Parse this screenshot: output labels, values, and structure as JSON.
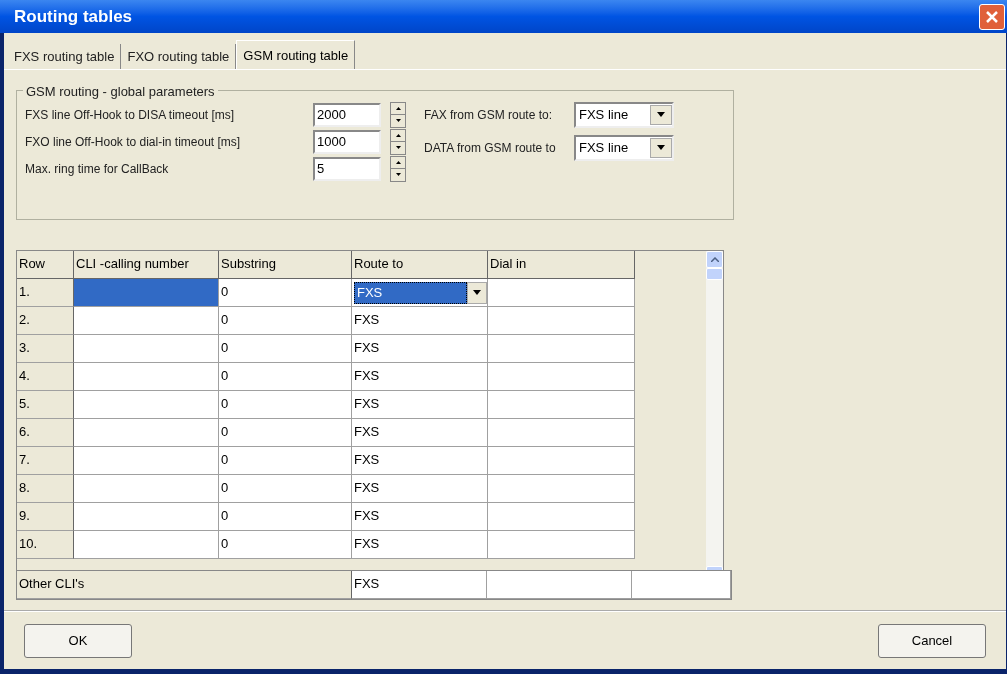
{
  "window": {
    "title": "Routing tables"
  },
  "tabs": [
    {
      "label": "FXS routing table",
      "selected": false
    },
    {
      "label": "FXO routing table",
      "selected": false
    },
    {
      "label": "GSM routing table",
      "selected": true
    }
  ],
  "global_parameters": {
    "title": "GSM routing - global parameters",
    "spinners": [
      {
        "label": "FXS line Off-Hook to DISA timeout [ms]",
        "value": "2000"
      },
      {
        "label": "FXO line Off-Hook to dial-in timeout [ms]",
        "value": "1000"
      },
      {
        "label": "Max. ring time for CallBack",
        "value": "5"
      }
    ],
    "dropdowns": [
      {
        "label": "FAX from GSM route to:",
        "value": "FXS line"
      },
      {
        "label": "DATA from GSM route to",
        "value": "FXS line"
      }
    ]
  },
  "table": {
    "columns": [
      "Row",
      "CLI -calling number",
      "Substring",
      "Route to",
      "Dial in"
    ],
    "rows": [
      {
        "row": "1.",
        "substring": "0",
        "route_to": "FXS",
        "selected": true
      },
      {
        "row": "2.",
        "substring": "0",
        "route_to": "FXS",
        "selected": false
      },
      {
        "row": "3.",
        "substring": "0",
        "route_to": "FXS",
        "selected": false
      },
      {
        "row": "4.",
        "substring": "0",
        "route_to": "FXS",
        "selected": false
      },
      {
        "row": "5.",
        "substring": "0",
        "route_to": "FXS",
        "selected": false
      },
      {
        "row": "6.",
        "substring": "0",
        "route_to": "FXS",
        "selected": false
      },
      {
        "row": "7.",
        "substring": "0",
        "route_to": "FXS",
        "selected": false
      },
      {
        "row": "8.",
        "substring": "0",
        "route_to": "FXS",
        "selected": false
      },
      {
        "row": "9.",
        "substring": "0",
        "route_to": "FXS",
        "selected": false
      },
      {
        "row": "10.",
        "substring": "0",
        "route_to": "FXS",
        "selected": false
      }
    ],
    "other": {
      "label": "Other CLI's",
      "route_to": "FXS"
    }
  },
  "buttons": [
    "OK",
    "Cancel"
  ]
}
